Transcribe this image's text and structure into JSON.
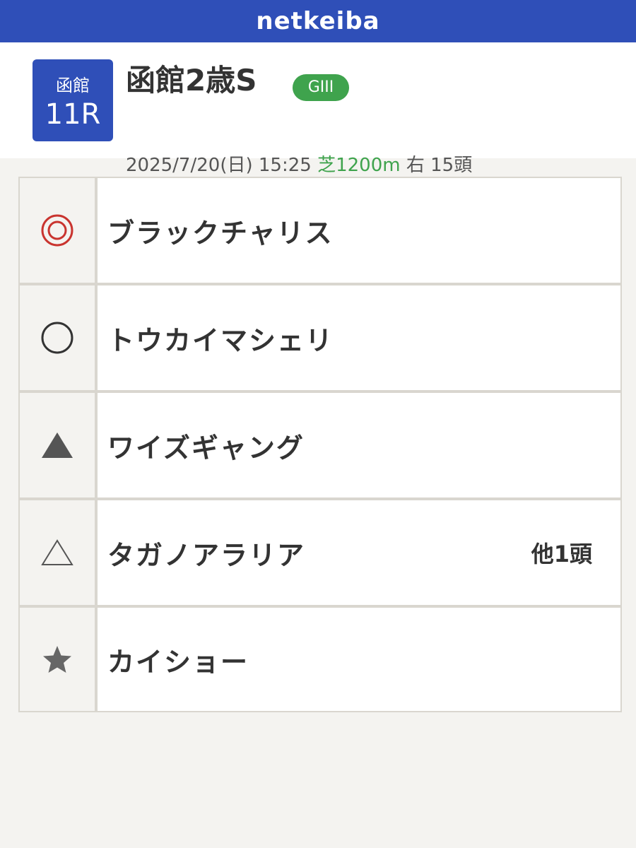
{
  "app": {
    "logo": "netkeiba"
  },
  "race": {
    "venue": "函館",
    "race_number": "11R",
    "name": "函館2歳S",
    "grade": "GIII",
    "date": "2025/7/20(日)",
    "time": "15:25",
    "surface_distance": "芝1200m",
    "direction": "右",
    "runners": "15頭"
  },
  "colors": {
    "header_blue": "#2f4fb8",
    "grade_green": "#3fa34d",
    "honmei_red": "#c9342f"
  },
  "picks": [
    {
      "mark": "◎",
      "icon": "double-circle-icon",
      "horse": "ブラックチャリス",
      "note": ""
    },
    {
      "mark": "○",
      "icon": "circle-icon",
      "horse": "トウカイマシェリ",
      "note": ""
    },
    {
      "mark": "▲",
      "icon": "filled-triangle-icon",
      "horse": "ワイズギャング",
      "note": ""
    },
    {
      "mark": "△",
      "icon": "outline-triangle-icon",
      "horse": "タガノアラリア",
      "note": "他1頭"
    },
    {
      "mark": "★",
      "icon": "star-icon",
      "horse": "カイショー",
      "note": ""
    }
  ]
}
